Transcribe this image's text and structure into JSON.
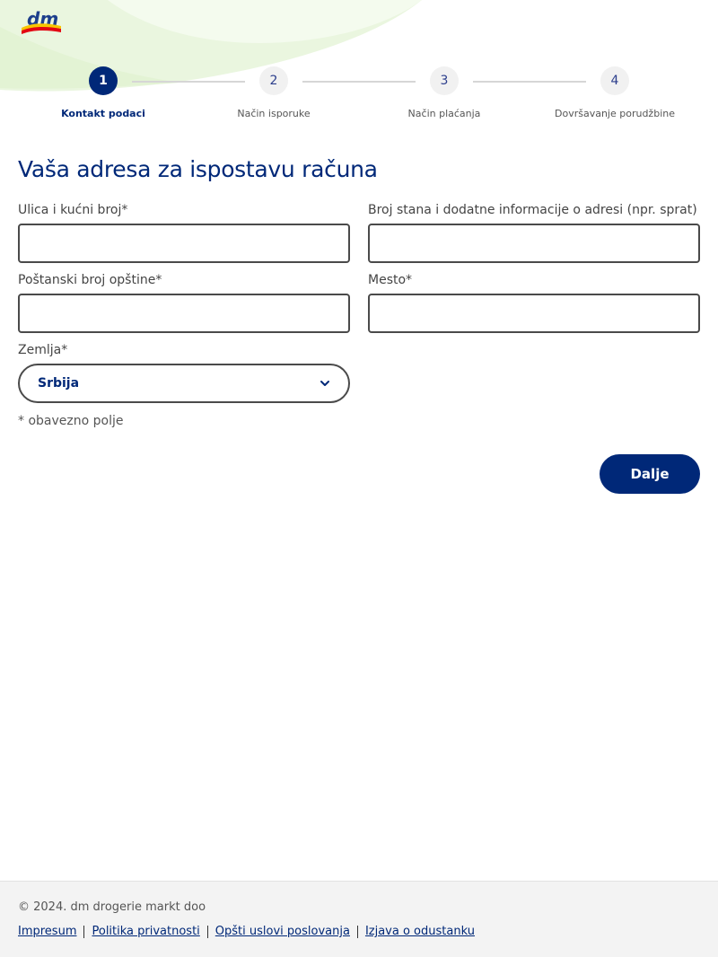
{
  "header": {
    "logo": "dm",
    "accent_color": "#002878"
  },
  "stepper": {
    "steps": [
      {
        "number": "1",
        "label": "Kontakt podaci",
        "active": true
      },
      {
        "number": "2",
        "label": "Način isporuke",
        "active": false
      },
      {
        "number": "3",
        "label": "Način plaćanja",
        "active": false
      },
      {
        "number": "4",
        "label": "Dovršavanje porudžbine",
        "active": false
      }
    ]
  },
  "form": {
    "title": "Vaša adresa za ispostavu računa",
    "street": {
      "label": "Ulica i kućni broj*",
      "value": ""
    },
    "apartment": {
      "label": "Broj stana i dodatne informacije o adresi (npr. sprat)",
      "value": ""
    },
    "postal_code": {
      "label": "Poštanski broj opštine*",
      "value": ""
    },
    "city": {
      "label": "Mesto*",
      "value": ""
    },
    "country": {
      "label": "Zemlja*",
      "selected": "Srbija",
      "icon": "chevron-down-icon"
    },
    "required_note": "* obavezno polje",
    "next_button": "Dalje"
  },
  "footer": {
    "copyright": "© 2024. dm drogerie markt doo",
    "links": [
      "Impresum",
      "Politika privatnosti",
      "Opšti uslovi poslovanja",
      "Izjava o odustanku"
    ]
  }
}
